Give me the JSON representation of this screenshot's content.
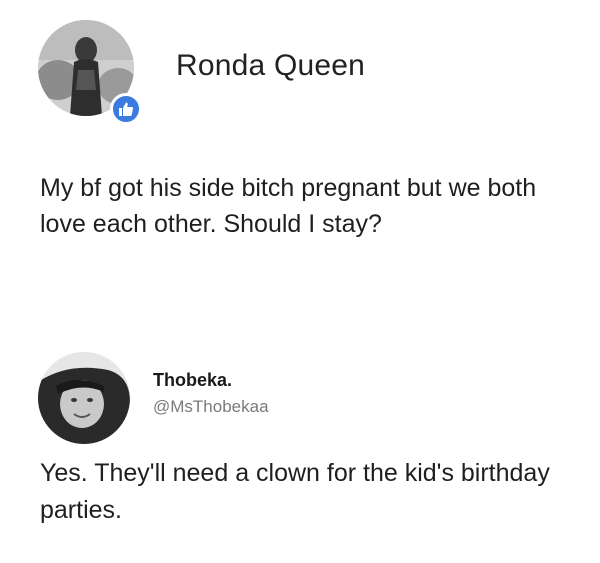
{
  "post": {
    "author": "Ronda Queen",
    "text": "My bf got his side bitch pregnant but we both love each other. Should I stay?",
    "avatar_icon": "profile-photo",
    "badge_icon": "thumbs-up-icon",
    "badge_color": "#3b7be0"
  },
  "reply": {
    "name": "Thobeka.",
    "handle": "@MsThobekaa",
    "text": "Yes. They'll need a clown for the kid's birthday parties.",
    "avatar_icon": "profile-photo"
  }
}
